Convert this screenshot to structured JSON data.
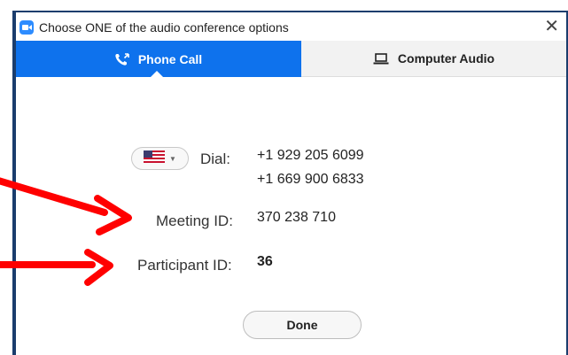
{
  "window": {
    "title": "Choose ONE of the audio conference options",
    "close_glyph": "✕"
  },
  "tabs": [
    {
      "label": "Phone Call",
      "icon": "phone-icon",
      "active": true
    },
    {
      "label": "Computer Audio",
      "icon": "laptop-icon",
      "active": false
    }
  ],
  "dial": {
    "label": "Dial:",
    "country_flag": "us-flag-icon",
    "numbers": [
      "+1 929 205 6099",
      "+1 669 900 6833"
    ]
  },
  "meeting": {
    "label": "Meeting ID:",
    "value": "370 238 710"
  },
  "participant": {
    "label": "Participant ID:",
    "value": "36"
  },
  "done_label": "Done",
  "colors": {
    "accent": "#0e72ed",
    "annotation_arrow": "#ff0000",
    "window_border": "#1b3d6d"
  }
}
